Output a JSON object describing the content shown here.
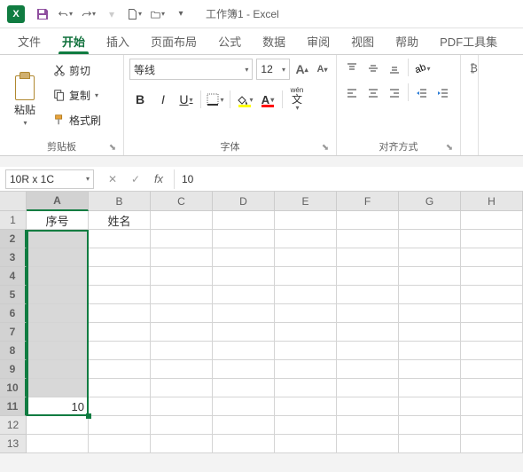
{
  "app": {
    "title": "工作簿1 - Excel",
    "logo_letter": "X"
  },
  "qat_icons": [
    "save-icon",
    "undo-icon",
    "redo-icon",
    "more-icon",
    "new-icon",
    "open-icon",
    "customize-icon"
  ],
  "tabs": [
    {
      "label": "文件"
    },
    {
      "label": "开始",
      "active": true
    },
    {
      "label": "插入"
    },
    {
      "label": "页面布局"
    },
    {
      "label": "公式"
    },
    {
      "label": "数据"
    },
    {
      "label": "审阅"
    },
    {
      "label": "视图"
    },
    {
      "label": "帮助"
    },
    {
      "label": "PDF工具集"
    }
  ],
  "clipboard": {
    "paste": "粘贴",
    "cut": "剪切",
    "copy": "复制",
    "format_painter": "格式刷",
    "group": "剪贴板"
  },
  "font": {
    "name": "等线",
    "size": "12",
    "group": "字体",
    "wen": "wén"
  },
  "align": {
    "group": "对齐方式"
  },
  "colors": {
    "fill": "#ffff00",
    "font": "#ff0000"
  },
  "namebox": "10R x 1C",
  "formula": "10",
  "columns": [
    "A",
    "B",
    "C",
    "D",
    "E",
    "F",
    "G",
    "H"
  ],
  "rows": [
    "1",
    "2",
    "3",
    "4",
    "5",
    "6",
    "7",
    "8",
    "9",
    "10",
    "11",
    "12",
    "13"
  ],
  "headers": {
    "A1": "序号",
    "B1": "姓名"
  },
  "cellA11": "10",
  "selection": {
    "col": "A",
    "rowStart": 2,
    "rowEnd": 11
  }
}
